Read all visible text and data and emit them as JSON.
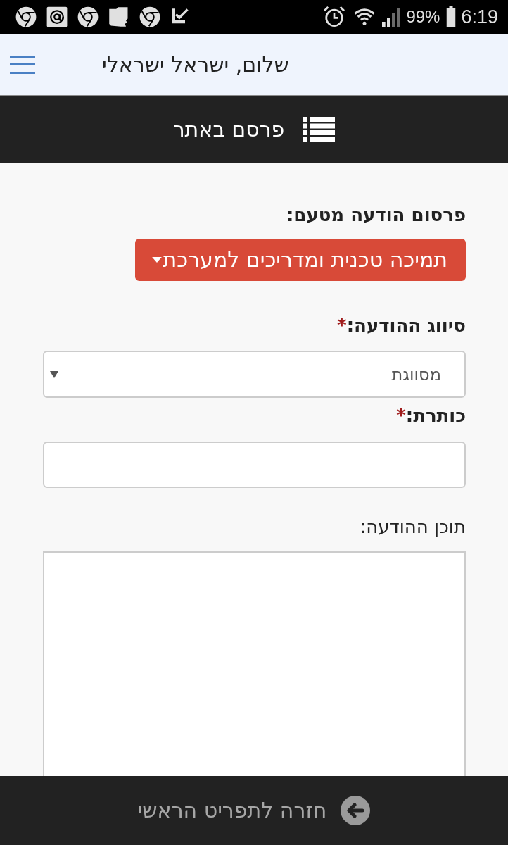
{
  "status_bar": {
    "battery": "99%",
    "time": "6:19"
  },
  "header": {
    "greeting": "שלום, ישראל ישראלי"
  },
  "title_bar": {
    "title": "פרסם באתר"
  },
  "form": {
    "publisher": {
      "label": "פרסום הודעה מטעם:",
      "value": "תמיכה טכנית ומדריכים למערכת"
    },
    "fields": [
      {
        "kind": "select",
        "label": "סיווג ההודעה:",
        "required_mark": "*",
        "value": "מסווגת"
      },
      {
        "kind": "text",
        "label": "כותרת:",
        "required_mark": "*"
      },
      {
        "kind": "textarea",
        "label": "תוכן ההודעה:"
      }
    ]
  },
  "footer": {
    "back_link": "חזרה לתפריט הראשי"
  }
}
